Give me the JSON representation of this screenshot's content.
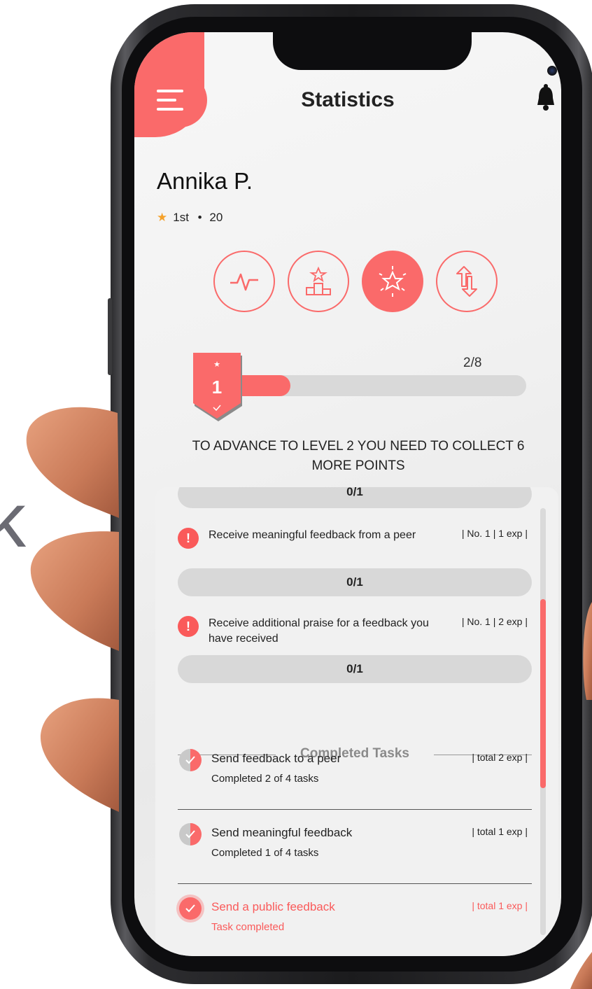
{
  "background_letter": "k",
  "header": {
    "title": "Statistics"
  },
  "user": {
    "name": "Annika P.",
    "rank": "1st",
    "separator": "•",
    "score": "20"
  },
  "nav_icons": [
    "activity-icon",
    "podium-icon",
    "star-burst-icon",
    "swap-arrows-icon"
  ],
  "level": {
    "current": "1",
    "progress_text": "2/8",
    "progress_fraction": 0.25,
    "advance_text": "TO ADVANCE TO LEVEL 2 YOU NEED TO COLLECT 6 MORE POINTS"
  },
  "open_tasks": [
    {
      "partial_bar_value": "0/1"
    },
    {
      "title": "Receive meaningful feedback from a peer",
      "meta": "| No. 1 | 1 exp |",
      "progress": "0/1"
    },
    {
      "title": "Receive additional praise for a feedback you have received",
      "meta": "| No. 1 | 2 exp |",
      "progress": "0/1"
    }
  ],
  "completed_section_title": "Completed Tasks",
  "completed_tasks": [
    {
      "title": "Send feedback to a peer",
      "meta": "| total 2 exp |",
      "subtitle": "Completed 2 of 4 tasks"
    },
    {
      "title": "Send meaningful feedback",
      "meta": "| total 1 exp |",
      "subtitle": "Completed 1 of 4 tasks"
    },
    {
      "title": "Send a public feedback",
      "meta": "| total 1 exp |",
      "subtitle": "Task completed"
    }
  ],
  "colors": {
    "accent": "#fa6a6a",
    "alert": "#fa5a5a",
    "rank_star": "#f5a12a"
  }
}
